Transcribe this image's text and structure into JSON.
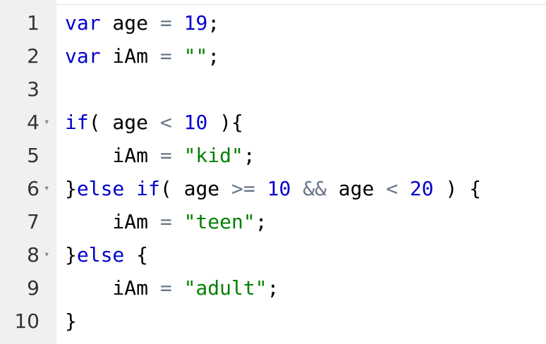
{
  "editor": {
    "lines": [
      {
        "num": "1",
        "fold": false,
        "tokens": [
          {
            "t": "var",
            "c": "kw"
          },
          {
            "t": " age ",
            "c": "id"
          },
          {
            "t": "=",
            "c": "op"
          },
          {
            "t": " ",
            "c": "id"
          },
          {
            "t": "19",
            "c": "num"
          },
          {
            "t": ";",
            "c": "punc"
          }
        ]
      },
      {
        "num": "2",
        "fold": false,
        "tokens": [
          {
            "t": "var",
            "c": "kw"
          },
          {
            "t": " iAm ",
            "c": "id"
          },
          {
            "t": "=",
            "c": "op"
          },
          {
            "t": " ",
            "c": "id"
          },
          {
            "t": "\"\"",
            "c": "str"
          },
          {
            "t": ";",
            "c": "punc"
          }
        ]
      },
      {
        "num": "3",
        "fold": false,
        "tokens": []
      },
      {
        "num": "4",
        "fold": true,
        "tokens": [
          {
            "t": "if",
            "c": "kw"
          },
          {
            "t": "( age ",
            "c": "id"
          },
          {
            "t": "<",
            "c": "op"
          },
          {
            "t": " ",
            "c": "id"
          },
          {
            "t": "10",
            "c": "num"
          },
          {
            "t": " ){",
            "c": "punc"
          }
        ]
      },
      {
        "num": "5",
        "fold": false,
        "tokens": [
          {
            "t": "    iAm ",
            "c": "id"
          },
          {
            "t": "=",
            "c": "op"
          },
          {
            "t": " ",
            "c": "id"
          },
          {
            "t": "\"kid\"",
            "c": "str"
          },
          {
            "t": ";",
            "c": "punc"
          }
        ]
      },
      {
        "num": "6",
        "fold": true,
        "tokens": [
          {
            "t": "}",
            "c": "punc"
          },
          {
            "t": "else",
            "c": "kw"
          },
          {
            "t": " ",
            "c": "id"
          },
          {
            "t": "if",
            "c": "kw"
          },
          {
            "t": "( age ",
            "c": "id"
          },
          {
            "t": ">=",
            "c": "op"
          },
          {
            "t": " ",
            "c": "id"
          },
          {
            "t": "10",
            "c": "num"
          },
          {
            "t": " ",
            "c": "id"
          },
          {
            "t": "&&",
            "c": "op"
          },
          {
            "t": " age ",
            "c": "id"
          },
          {
            "t": "<",
            "c": "op"
          },
          {
            "t": " ",
            "c": "id"
          },
          {
            "t": "20",
            "c": "num"
          },
          {
            "t": " ) {",
            "c": "punc"
          }
        ]
      },
      {
        "num": "7",
        "fold": false,
        "tokens": [
          {
            "t": "    iAm ",
            "c": "id"
          },
          {
            "t": "=",
            "c": "op"
          },
          {
            "t": " ",
            "c": "id"
          },
          {
            "t": "\"teen\"",
            "c": "str"
          },
          {
            "t": ";",
            "c": "punc"
          }
        ]
      },
      {
        "num": "8",
        "fold": true,
        "tokens": [
          {
            "t": "}",
            "c": "punc"
          },
          {
            "t": "else",
            "c": "kw"
          },
          {
            "t": " {",
            "c": "punc"
          }
        ]
      },
      {
        "num": "9",
        "fold": false,
        "tokens": [
          {
            "t": "    iAm ",
            "c": "id"
          },
          {
            "t": "=",
            "c": "op"
          },
          {
            "t": " ",
            "c": "id"
          },
          {
            "t": "\"adult\"",
            "c": "str"
          },
          {
            "t": ";",
            "c": "punc"
          }
        ]
      },
      {
        "num": "10",
        "fold": false,
        "tokens": [
          {
            "t": "}",
            "c": "punc"
          }
        ]
      }
    ],
    "fold_icon": "fold-arrow-down-icon",
    "colors": {
      "keyword": "#0000cc",
      "number": "#0000cc",
      "string": "#008000",
      "operator": "#687687",
      "gutter": "#f0f0f0"
    }
  }
}
